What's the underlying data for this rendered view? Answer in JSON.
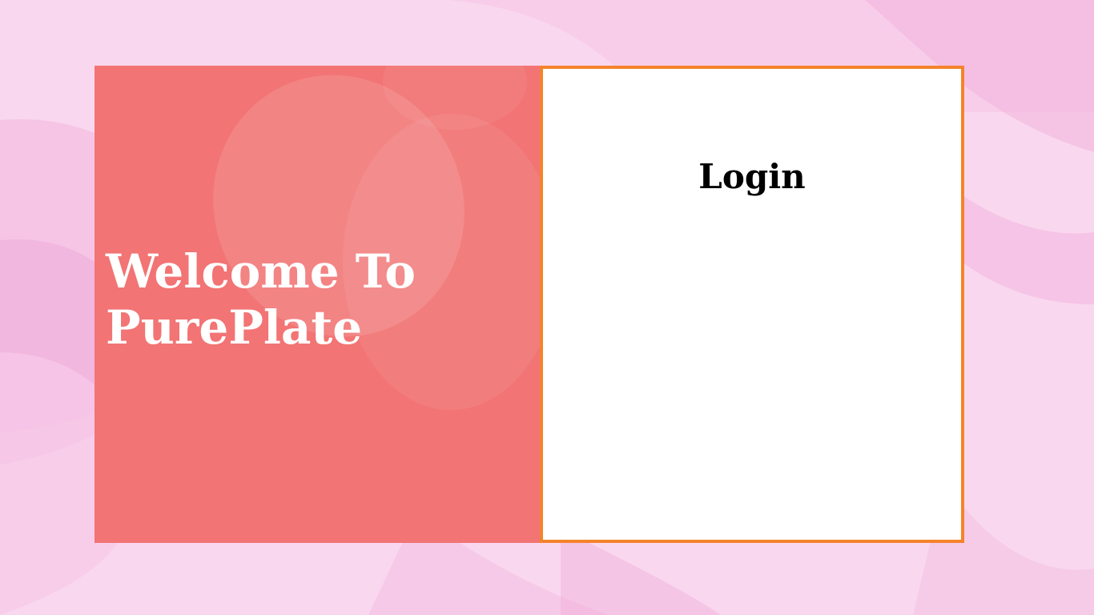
{
  "welcome": {
    "line1": "Welcome To",
    "line2": "PurePlate"
  },
  "login": {
    "title": "Login"
  },
  "colors": {
    "background": "#f8d6ee",
    "left_panel": "#f27474",
    "right_panel_border": "#f5832b",
    "right_panel": "#ffffff",
    "welcome_text": "#ffffff",
    "login_text": "#000000"
  }
}
